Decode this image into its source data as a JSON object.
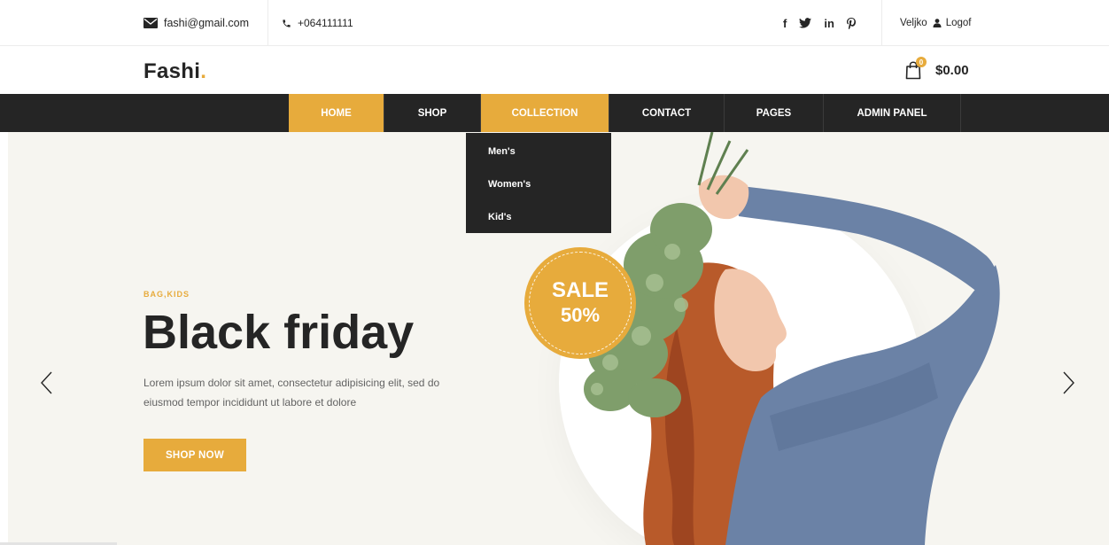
{
  "topbar": {
    "email": "fashi@gmail.com",
    "phone": "+064111111",
    "social": [
      "f",
      "twitter-icon",
      "in",
      "pinterest-icon"
    ],
    "user_name": "Veljko",
    "logout_label": "Logof"
  },
  "header": {
    "logo_text": "Fashi",
    "logo_dot": ".",
    "cart_count": "0",
    "cart_total": "$0.00"
  },
  "nav": {
    "items": [
      {
        "label": "HOME",
        "active": true
      },
      {
        "label": "SHOP",
        "active": false
      },
      {
        "label": "COLLECTION",
        "active": false
      },
      {
        "label": "CONTACT",
        "active": false
      },
      {
        "label": "PAGES",
        "active": false
      },
      {
        "label": "ADMIN PANEL",
        "active": false
      }
    ]
  },
  "dropdown": {
    "items": [
      "Men's",
      "Women's",
      "Kid's"
    ]
  },
  "hero": {
    "kicker": "BAG,KIDS",
    "headline": "Black friday",
    "description": "Lorem ipsum dolor sit amet, consectetur adipisicing elit, sed do eiusmod tempor incididunt ut labore et dolore",
    "button_label": "SHOP NOW",
    "sale_line1": "SALE",
    "sale_line2": "50%"
  },
  "colors": {
    "accent": "#e7ab3c",
    "dark": "#252525",
    "hero_bg": "#f6f5f0"
  }
}
